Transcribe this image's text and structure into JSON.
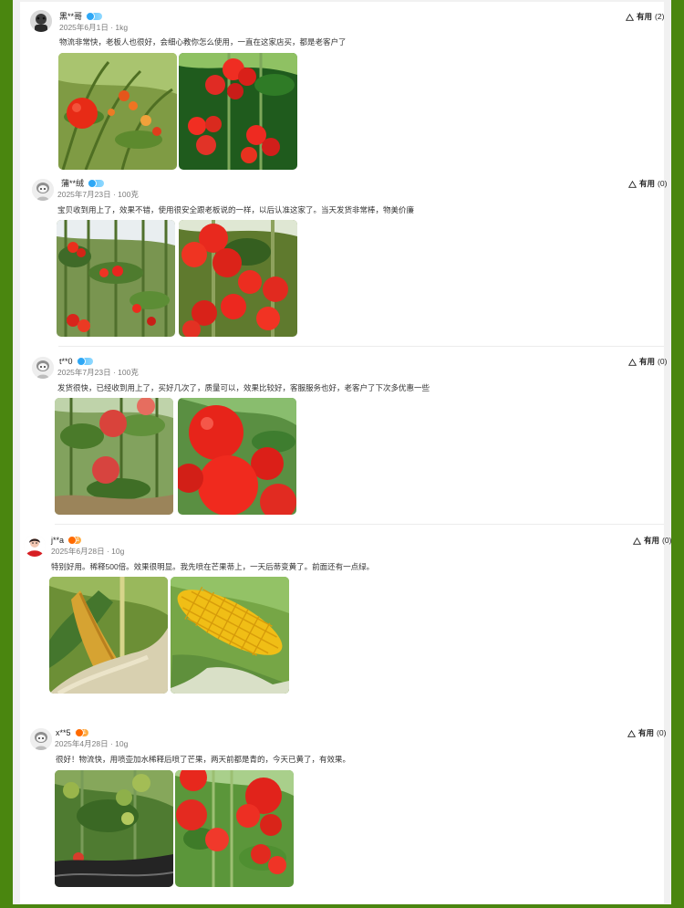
{
  "reviews": [
    {
      "username": "黑**哥",
      "badge_level": "",
      "meta": "2025年6月1日 · 1kg",
      "comment": "物流非常快，老板人也很好，会细心教你怎么使用，一直在这家店买，都是老客户了",
      "useful_label": "有用",
      "useful_count": "(2)",
      "photos": [
        "tomato-plant-photo",
        "tomato-cluster-photo"
      ]
    },
    {
      "username": "蒲**绒",
      "badge_level": "",
      "meta": "2025年7月23日 · 100克",
      "comment": "宝贝收到用上了，效果不错，使用很安全跟老板说的一样，以后认准这家了。当天发货非常棒，物美价廉",
      "useful_label": "有用",
      "useful_count": "(0)",
      "photos": [
        "greenhouse-tomato-photo",
        "red-tomato-cluster-photo"
      ]
    },
    {
      "username": "t**0",
      "badge_level": "",
      "meta": "2025年7月23日 · 100克",
      "comment": "发货很快，已经收到用上了，买好几次了，质量可以，效果比较好，客服服务也好，老客户了下次多优惠一些",
      "useful_label": "有用",
      "useful_count": "(0)",
      "photos": [
        "tomato-vine-photo",
        "ripe-tomato-closeup-photo"
      ]
    },
    {
      "username": "j**a",
      "badge_level": "1",
      "meta": "2025年6月28日 · 10g",
      "comment": "特别好用。稀释500倍。效果很明显。我先喷在芒果蒂上，一天后蒂变黄了。前面还有一点绿。",
      "useful_label": "有用",
      "useful_count": "(0)",
      "photos": [
        "dry-corn-photo",
        "yellow-corn-photo"
      ]
    },
    {
      "username": "x**5",
      "badge_level": "1",
      "meta": "2025年4月28日 · 10g",
      "comment": "很好！物流快，用喷壶加水稀释后喷了芒果，两天前都是青的，今天已黄了，有效果。",
      "useful_label": "有用",
      "useful_count": "(0)",
      "photos": [
        "green-tomato-photo",
        "red-tomato-vine-photo"
      ]
    }
  ],
  "colors": {
    "background_green": "#4f8a12",
    "sheet_gray": "#f1f1f1",
    "card_white": "#ffffff",
    "badge_blue": "#57c2ff",
    "badge_orange": "#ff8b18"
  }
}
